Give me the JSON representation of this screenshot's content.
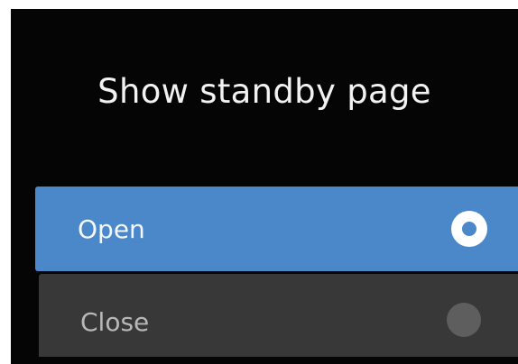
{
  "dialog": {
    "title": "Show standby page",
    "options": [
      {
        "label": "Open",
        "selected": true
      },
      {
        "label": "Close",
        "selected": false
      }
    ]
  },
  "colors": {
    "background": "#050505",
    "selected_row": "#4a88c9",
    "unselected_row": "#383838",
    "title_text": "#f2f2f2",
    "radio_on": "#ffffff",
    "radio_off": "#5e5e5e"
  },
  "icons": {
    "selected": "radio-button-checked-icon",
    "unselected": "radio-button-unchecked-icon"
  }
}
